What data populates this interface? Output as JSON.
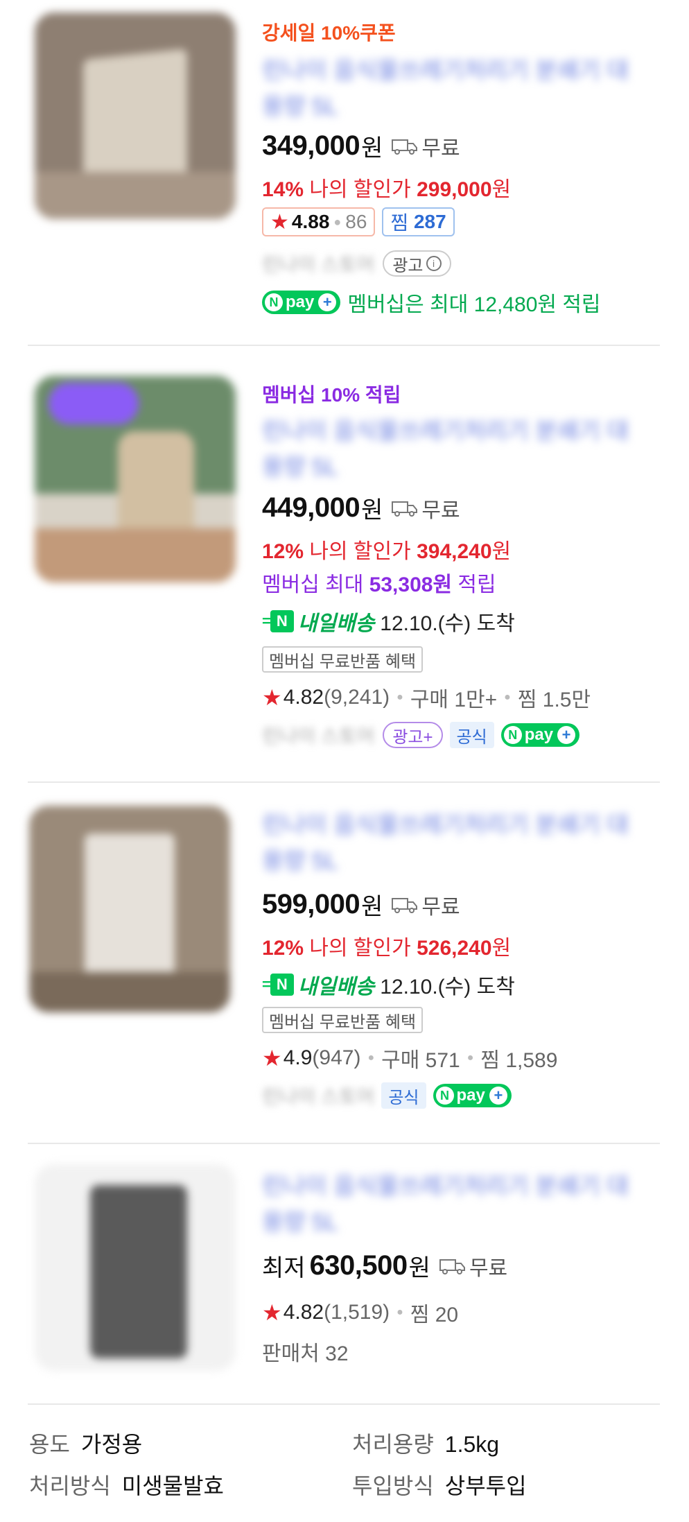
{
  "products": [
    {
      "promo": "강세일 10%쿠폰",
      "title": "린나이 음식물쓰레기처리기 분쇄기 대용량 5L",
      "price": "349,000",
      "price_unit": "원",
      "shipping": "무료",
      "discount_pct": "14%",
      "discount_label": "나의 할인가",
      "discount_price": "299,000",
      "discount_unit": "원",
      "rating": "4.88",
      "review_count": "86",
      "zzim_label": "찜",
      "zzim_count": "287",
      "seller": "린나이 스토어",
      "ad_label": "광고",
      "npay_text": "멤버십은 최대 12,480원 적립"
    },
    {
      "promo": "멤버십 10% 적립",
      "title": "린나이 음식물쓰레기처리기 분쇄기 대용량 5L",
      "price": "449,000",
      "price_unit": "원",
      "shipping": "무료",
      "discount_pct": "12%",
      "discount_label": "나의 할인가",
      "discount_price": "394,240",
      "discount_unit": "원",
      "membership_prefix": "멤버십 최대",
      "membership_amount": "53,308원",
      "membership_suffix": "적립",
      "delivery_label": "내일배송",
      "delivery_date": "12.10.(수) 도착",
      "benefit_tag": "멤버십 무료반품 혜택",
      "rating": "4.82",
      "review_count": "(9,241)",
      "purchase": "구매 1만+",
      "zzim": "찜 1.5만",
      "seller": "린나이 스토어",
      "ad_label": "광고+",
      "official_label": "공식"
    },
    {
      "title": "린나이 음식물쓰레기처리기 분쇄기 대용량 5L",
      "price": "599,000",
      "price_unit": "원",
      "shipping": "무료",
      "discount_pct": "12%",
      "discount_label": "나의 할인가",
      "discount_price": "526,240",
      "discount_unit": "원",
      "delivery_label": "내일배송",
      "delivery_date": "12.10.(수) 도착",
      "benefit_tag": "멤버십 무료반품 혜택",
      "rating": "4.9",
      "review_count": "(947)",
      "purchase": "구매 571",
      "zzim": "찜 1,589",
      "seller": "린나이 스토어",
      "official_label": "공식"
    },
    {
      "title": "린나이 음식물쓰레기처리기 분쇄기 대용량 5L",
      "lowest_label": "최저",
      "price": "630,500",
      "price_unit": "원",
      "shipping": "무료",
      "rating": "4.82",
      "review_count": "(1,519)",
      "zzim": "찜 20",
      "sellers": "판매처 32"
    }
  ],
  "npay_label": "pay",
  "specs": [
    {
      "label": "용도",
      "value": "가정용"
    },
    {
      "label": "처리용량",
      "value": "1.5kg"
    },
    {
      "label": "처리방식",
      "value": "미생물발효"
    },
    {
      "label": "투입방식",
      "value": "상부투입"
    }
  ],
  "colors": {
    "promo_orange": "#f4511e",
    "promo_purple": "#8a2be2",
    "discount_red": "#e3262f",
    "npay_green": "#03c75a",
    "official_blue": "#2d6bd4"
  }
}
